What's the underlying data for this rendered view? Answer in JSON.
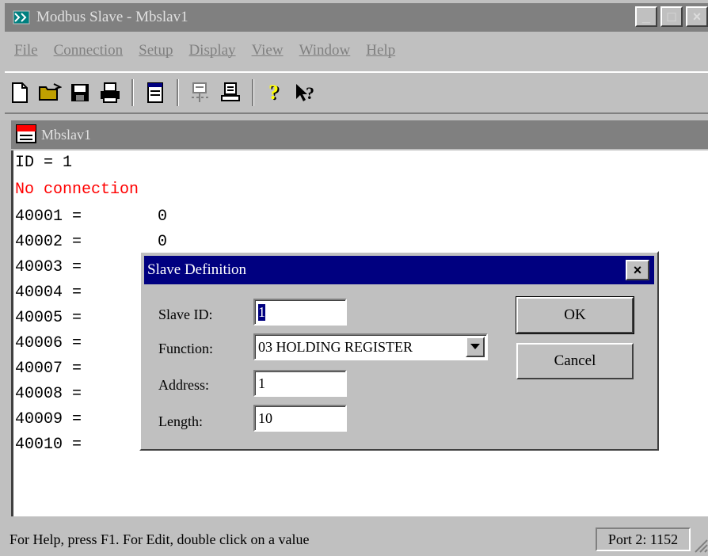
{
  "window": {
    "title": "Modbus Slave - Mbslav1",
    "controls": [
      "_",
      "□",
      "×"
    ]
  },
  "menu": [
    "File",
    "Connection",
    "Setup",
    "Display",
    "View",
    "Window",
    "Help"
  ],
  "toolbar": [
    "new-icon",
    "open-icon",
    "save-icon",
    "print-icon",
    "view-icon",
    "connect-icon",
    "disconnect-icon",
    "help-icon",
    "context-help-icon"
  ],
  "child": {
    "title": "Mbslav1"
  },
  "client": {
    "lines": [
      {
        "text": "ID = 1"
      },
      {
        "text": "No connection"
      },
      {
        "text": "40001 =        0"
      },
      {
        "text": "40002 =        0"
      },
      {
        "text": "40003 ="
      },
      {
        "text": "40004 ="
      },
      {
        "text": "40005 ="
      },
      {
        "text": "40006 ="
      },
      {
        "text": "40007 ="
      },
      {
        "text": "40008 ="
      },
      {
        "text": "40009 ="
      },
      {
        "text": "40010 ="
      }
    ]
  },
  "dialog": {
    "title": "Slave Definition",
    "slave_id_label": "Slave ID:",
    "slave_id_value": "1",
    "function_label": "Function:",
    "function_value": "03 HOLDING REGISTER",
    "address_label": "Address:",
    "address_value": "1",
    "length_label": "Length:",
    "length_value": "10",
    "ok_label": "OK",
    "cancel_label": "Cancel"
  },
  "status": {
    "text": "For Help, press F1.   For Edit, double click on a value",
    "port": "Port 2: 1152"
  }
}
